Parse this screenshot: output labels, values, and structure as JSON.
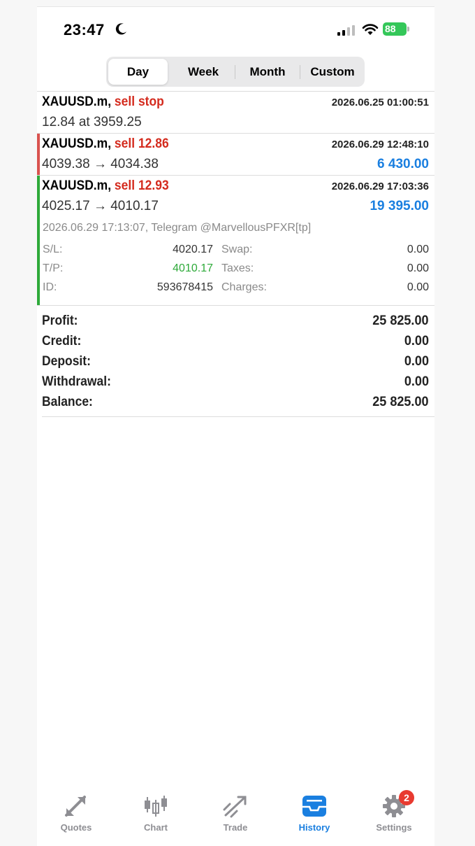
{
  "status_bar": {
    "time": "23:47",
    "battery": "88"
  },
  "segments": [
    "Day",
    "Week",
    "Month",
    "Custom"
  ],
  "selected_segment": "Day",
  "orders": [
    {
      "symbol": "XAUUSD.m,",
      "action": "sell stop",
      "time": "2026.06.25 01:00:51",
      "detail": "12.84 at 3959.25"
    }
  ],
  "deals": [
    {
      "symbol": "XAUUSD.m,",
      "action": "sell 12.86",
      "time": "2026.06.29 12:48:10",
      "prices": "4039.38 → 4034.38",
      "profit": "6 430.00",
      "accent": "#d9534f"
    },
    {
      "symbol": "XAUUSD.m,",
      "action": "sell 12.93",
      "time": "2026.06.29 17:03:36",
      "prices": "4025.17 → 4010.17",
      "profit": "19 395.00",
      "accent": "#2eaa3a",
      "comment": "2026.06.29 17:13:07, Telegram @MarvellousPFXR[tp]",
      "details": {
        "sl_label": "S/L:",
        "sl": "4020.17",
        "tp_label": "T/P:",
        "tp": "4010.17",
        "id_label": "ID:",
        "id": "593678415",
        "swap_label": "Swap:",
        "swap": "0.00",
        "taxes_label": "Taxes:",
        "taxes": "0.00",
        "charges_label": "Charges:",
        "charges": "0.00"
      }
    }
  ],
  "summary": [
    {
      "label": "Profit:",
      "value": "25 825.00"
    },
    {
      "label": "Credit:",
      "value": "0.00"
    },
    {
      "label": "Deposit:",
      "value": "0.00"
    },
    {
      "label": "Withdrawal:",
      "value": "0.00"
    },
    {
      "label": "Balance:",
      "value": "25 825.00"
    }
  ],
  "tabs": [
    {
      "label": "Quotes",
      "icon": "quotes-icon"
    },
    {
      "label": "Chart",
      "icon": "candlestick-icon"
    },
    {
      "label": "Trade",
      "icon": "trade-icon"
    },
    {
      "label": "History",
      "icon": "inbox-icon",
      "active": true
    },
    {
      "label": "Settings",
      "icon": "gear-icon",
      "badge": "2"
    }
  ],
  "colors": {
    "accent_blue": "#1a7fe0",
    "sell_red": "#d42b1e",
    "profit_green": "#2eaa3a",
    "loss_bar": "#d9534f"
  }
}
